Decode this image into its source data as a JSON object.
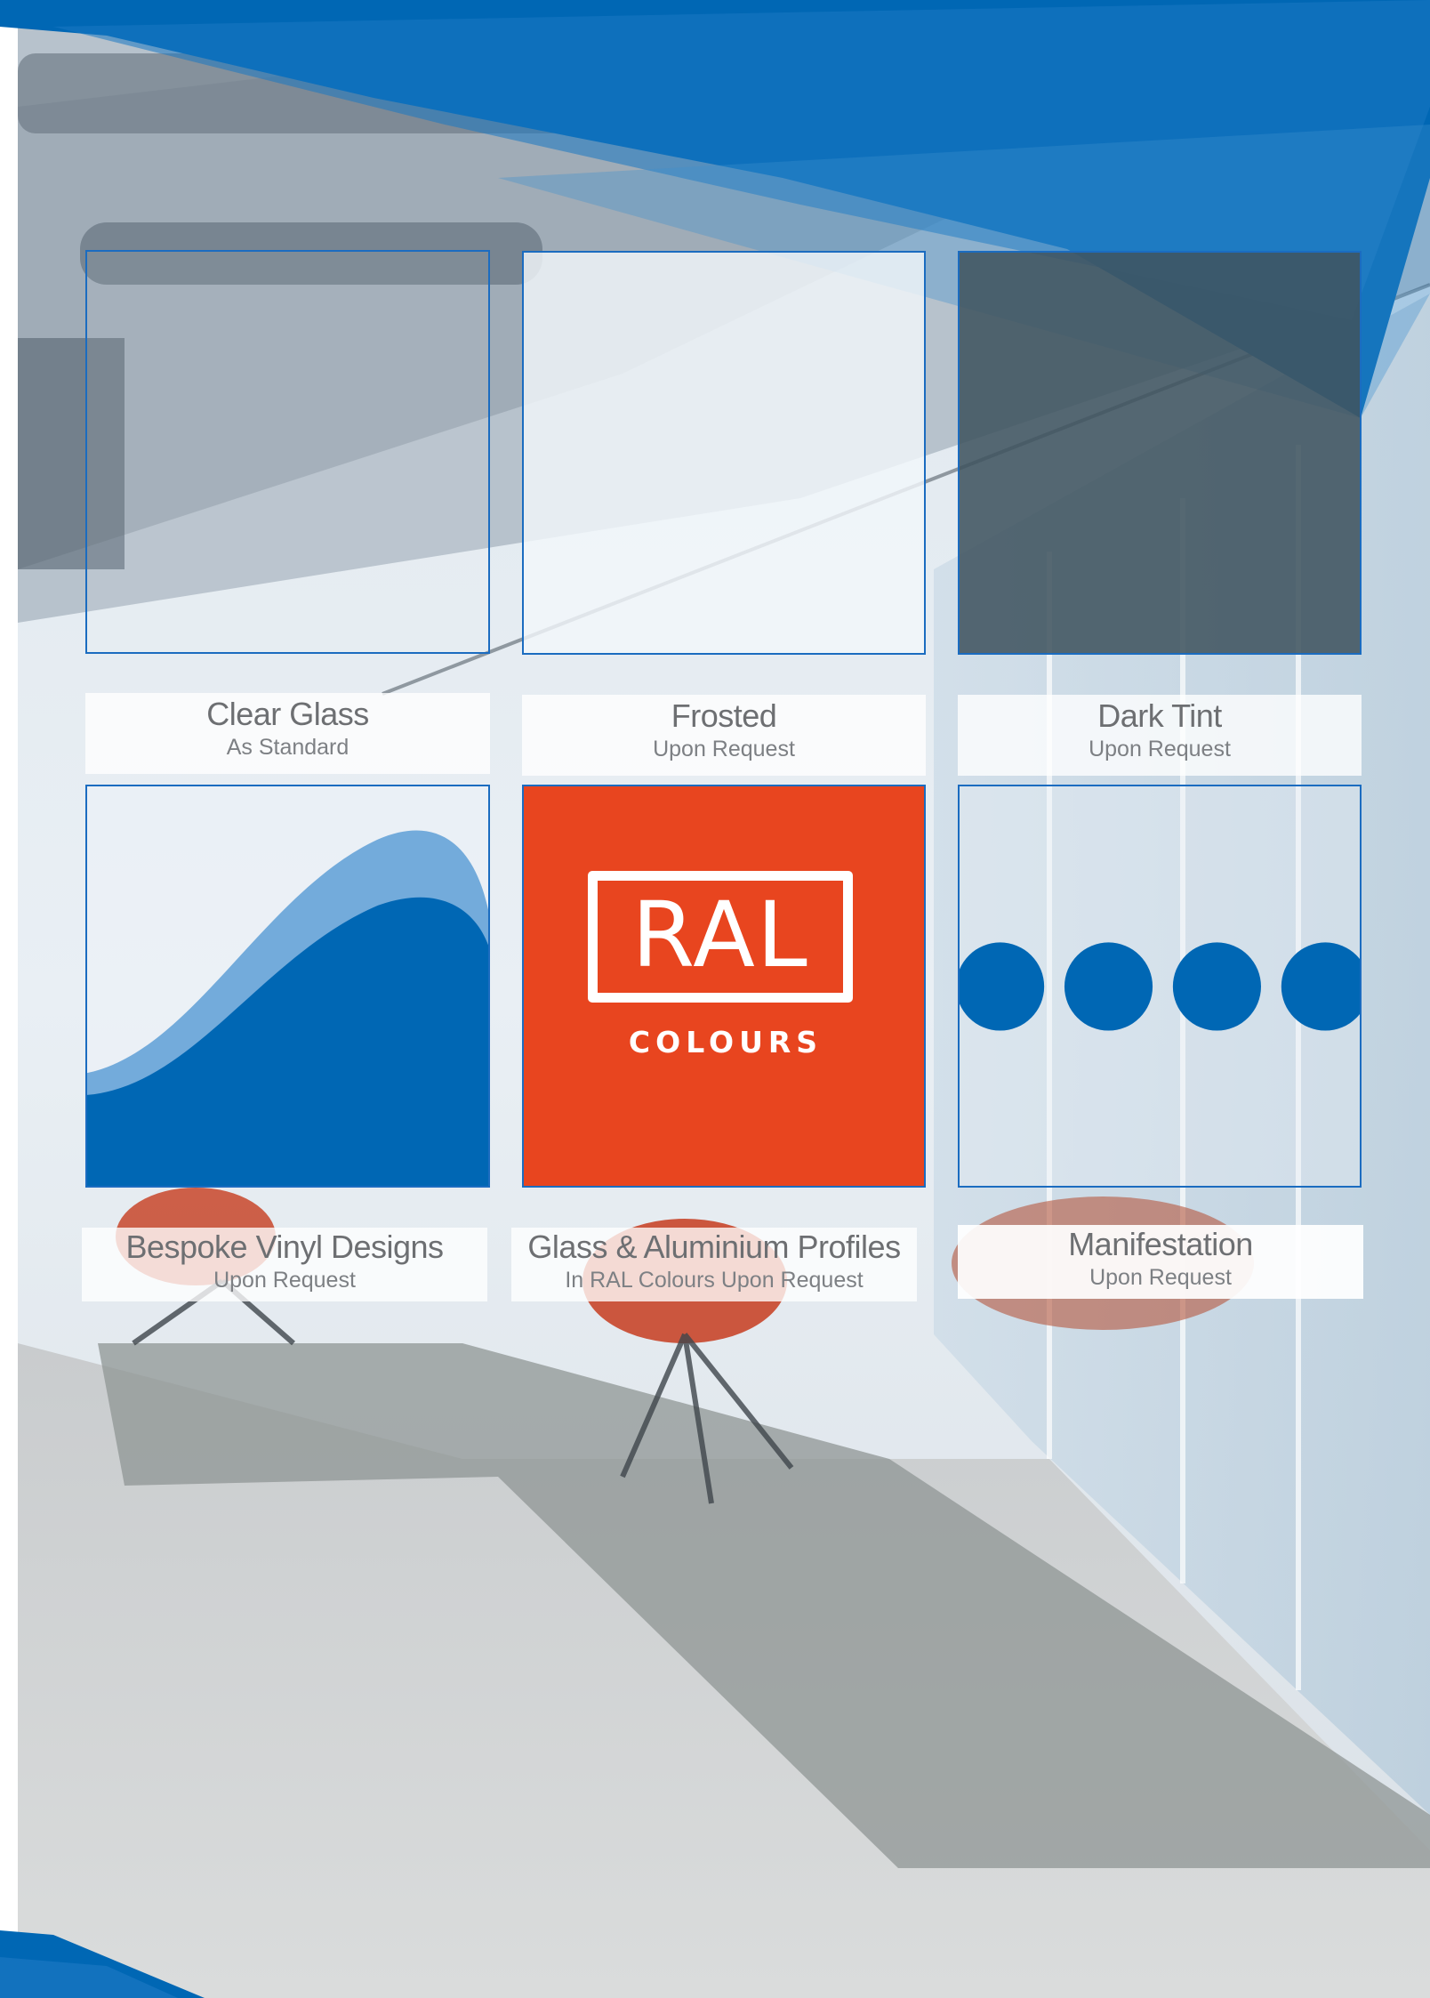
{
  "colors": {
    "brand_blue": "#0067b4",
    "tile_border": "#1b6cc0",
    "ral_orange": "#e8451f",
    "dark_tint": "#4e616b",
    "caption_text": "#6d6f72"
  },
  "options": [
    {
      "id": "clear-glass",
      "title": "Clear Glass",
      "subtitle": "As Standard",
      "swatch": "clear"
    },
    {
      "id": "frosted",
      "title": "Frosted",
      "subtitle": "Upon Request",
      "swatch": "frosted"
    },
    {
      "id": "dark-tint",
      "title": "Dark Tint",
      "subtitle": "Upon Request",
      "swatch": "dark-tint"
    },
    {
      "id": "bespoke-vinyl",
      "title": "Bespoke Vinyl Designs",
      "subtitle": "Upon Request",
      "swatch": "wave-graphic"
    },
    {
      "id": "profiles",
      "title": "Glass & Aluminium Profiles",
      "subtitle": "In RAL Colours Upon Request",
      "swatch": "ral-logo"
    },
    {
      "id": "manifestation",
      "title": "Manifestation",
      "subtitle": "Upon Request",
      "swatch": "dots-graphic"
    }
  ],
  "ral_logo": {
    "mark": "RAL",
    "word": "COLOURS"
  }
}
